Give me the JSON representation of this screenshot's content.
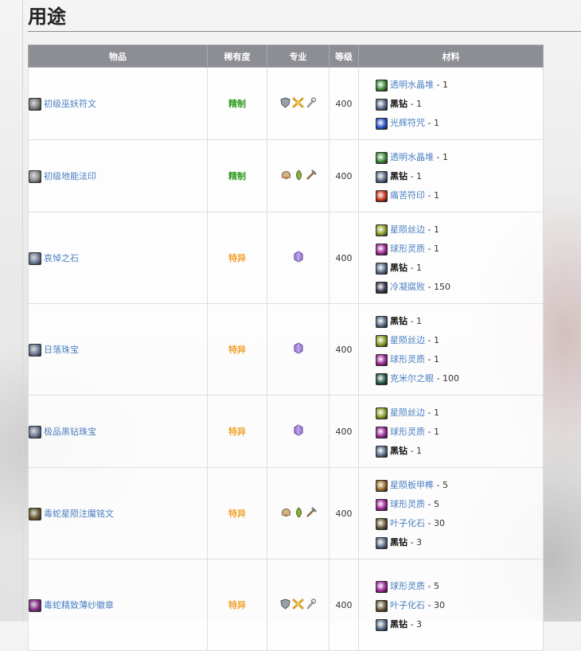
{
  "section": {
    "title": "用途"
  },
  "columns": {
    "item": "物品",
    "rarity": "稀有度",
    "profession": "专业",
    "level": "等级",
    "materials": "材料"
  },
  "rows": [
    {
      "item": "初级巫妖符文",
      "item_icon": "rune-orb-icon",
      "item_color": "#7b7b7b",
      "rarity": "精制",
      "rarity_class": "epic",
      "profession": "trio",
      "level": "400",
      "materials": [
        {
          "name": "透明水晶堆",
          "qty": " - 1",
          "icon": "crystal-pile-icon",
          "color": "#3d8a3a",
          "plain": false
        },
        {
          "name": "黑钻",
          "qty": " - 1",
          "icon": "black-diamond-icon",
          "color": "#5b6e88",
          "plain": true
        },
        {
          "name": "光辉符咒",
          "qty": " - 1",
          "icon": "radiant-charm-icon",
          "color": "#2a55c8",
          "plain": false
        }
      ]
    },
    {
      "item": "初级地能法印",
      "item_icon": "earth-sigil-icon",
      "item_color": "#8a8a8a",
      "rarity": "精制",
      "rarity_class": "epic",
      "profession": "tools",
      "level": "400",
      "materials": [
        {
          "name": "透明水晶堆",
          "qty": " - 1",
          "icon": "crystal-pile-icon",
          "color": "#3d8a3a",
          "plain": false
        },
        {
          "name": "黑钻",
          "qty": " - 1",
          "icon": "black-diamond-icon",
          "color": "#5b6e88",
          "plain": true
        },
        {
          "name": "痛苦符印",
          "qty": " - 1",
          "icon": "pain-sigil-icon",
          "color": "#c8361f",
          "plain": false
        }
      ]
    },
    {
      "item": "哀悼之石",
      "item_icon": "mourning-stone-icon",
      "item_color": "#6a7a96",
      "rarity": "特异",
      "rarity_class": "rare",
      "profession": "gem",
      "level": "400",
      "materials": [
        {
          "name": "星陨丝边",
          "qty": " - 1",
          "icon": "starfall-lace-icon",
          "color": "#8aa026",
          "plain": false
        },
        {
          "name": "球形灵质",
          "qty": " - 1",
          "icon": "spirit-orb-icon",
          "color": "#a02a9a",
          "plain": false
        },
        {
          "name": "黑钻",
          "qty": " - 1",
          "icon": "black-diamond-icon",
          "color": "#5b6e88",
          "plain": true
        },
        {
          "name": "冷凝腐败",
          "qty": " - 150",
          "icon": "condensed-rot-icon",
          "color": "#3d3d55",
          "plain": false
        }
      ]
    },
    {
      "item": "日落珠宝",
      "item_icon": "sunset-jewel-icon",
      "item_color": "#6a7a96",
      "rarity": "特异",
      "rarity_class": "rare",
      "profession": "gem",
      "level": "400",
      "materials": [
        {
          "name": "黑钻",
          "qty": " - 1",
          "icon": "black-diamond-icon",
          "color": "#5b6e88",
          "plain": true
        },
        {
          "name": "星陨丝边",
          "qty": " - 1",
          "icon": "starfall-lace-icon",
          "color": "#8aa026",
          "plain": false
        },
        {
          "name": "球形灵质",
          "qty": " - 1",
          "icon": "spirit-orb-icon",
          "color": "#a02a9a",
          "plain": false
        },
        {
          "name": "克米尔之眼",
          "qty": " - 100",
          "icon": "kamir-eye-icon",
          "color": "#2a5a4a",
          "plain": false
        }
      ]
    },
    {
      "item": "极品黑钻珠宝",
      "item_icon": "black-diamond-jewel-icon",
      "item_color": "#6a7a96",
      "rarity": "特异",
      "rarity_class": "rare",
      "profession": "gem",
      "level": "400",
      "materials": [
        {
          "name": "星陨丝边",
          "qty": " - 1",
          "icon": "starfall-lace-icon",
          "color": "#8aa026",
          "plain": false
        },
        {
          "name": "球形灵质",
          "qty": " - 1",
          "icon": "spirit-orb-icon",
          "color": "#a02a9a",
          "plain": false
        },
        {
          "name": "黑钻",
          "qty": " - 1",
          "icon": "black-diamond-icon",
          "color": "#5b6e88",
          "plain": true
        }
      ]
    },
    {
      "item": "毒蛇星陨注魔铭文",
      "item_icon": "serpent-inscription-icon",
      "item_color": "#6a5a2a",
      "rarity": "特异",
      "rarity_class": "rare",
      "profession": "tools",
      "level": "400",
      "materials": [
        {
          "name": "星陨板甲榫",
          "qty": " - 5",
          "icon": "starfall-plate-icon",
          "color": "#9a6a2a",
          "plain": false
        },
        {
          "name": "球形灵质",
          "qty": " - 5",
          "icon": "spirit-orb-icon",
          "color": "#a02a9a",
          "plain": false
        },
        {
          "name": "叶子化石",
          "qty": " - 30",
          "icon": "leaf-fossil-icon",
          "color": "#6a5a3a",
          "plain": false
        },
        {
          "name": "黑钻",
          "qty": " - 3",
          "icon": "black-diamond-icon",
          "color": "#5b6e88",
          "plain": true
        }
      ]
    },
    {
      "item": "毒蛇精致薄纱徽章",
      "item_icon": "serpent-badge-icon",
      "item_color": "#8a2a8a",
      "rarity": "特异",
      "rarity_class": "rare",
      "profession": "trio",
      "level": "400",
      "materials": [
        {
          "name": "球形灵质",
          "qty": " - 5",
          "icon": "spirit-orb-icon",
          "color": "#a02a9a",
          "plain": false
        },
        {
          "name": "叶子化石",
          "qty": " - 30",
          "icon": "leaf-fossil-icon",
          "color": "#6a5a3a",
          "plain": false
        },
        {
          "name": "黑钻",
          "qty": " - 3",
          "icon": "black-diamond-icon",
          "color": "#5b6e88",
          "plain": true
        }
      ]
    }
  ]
}
